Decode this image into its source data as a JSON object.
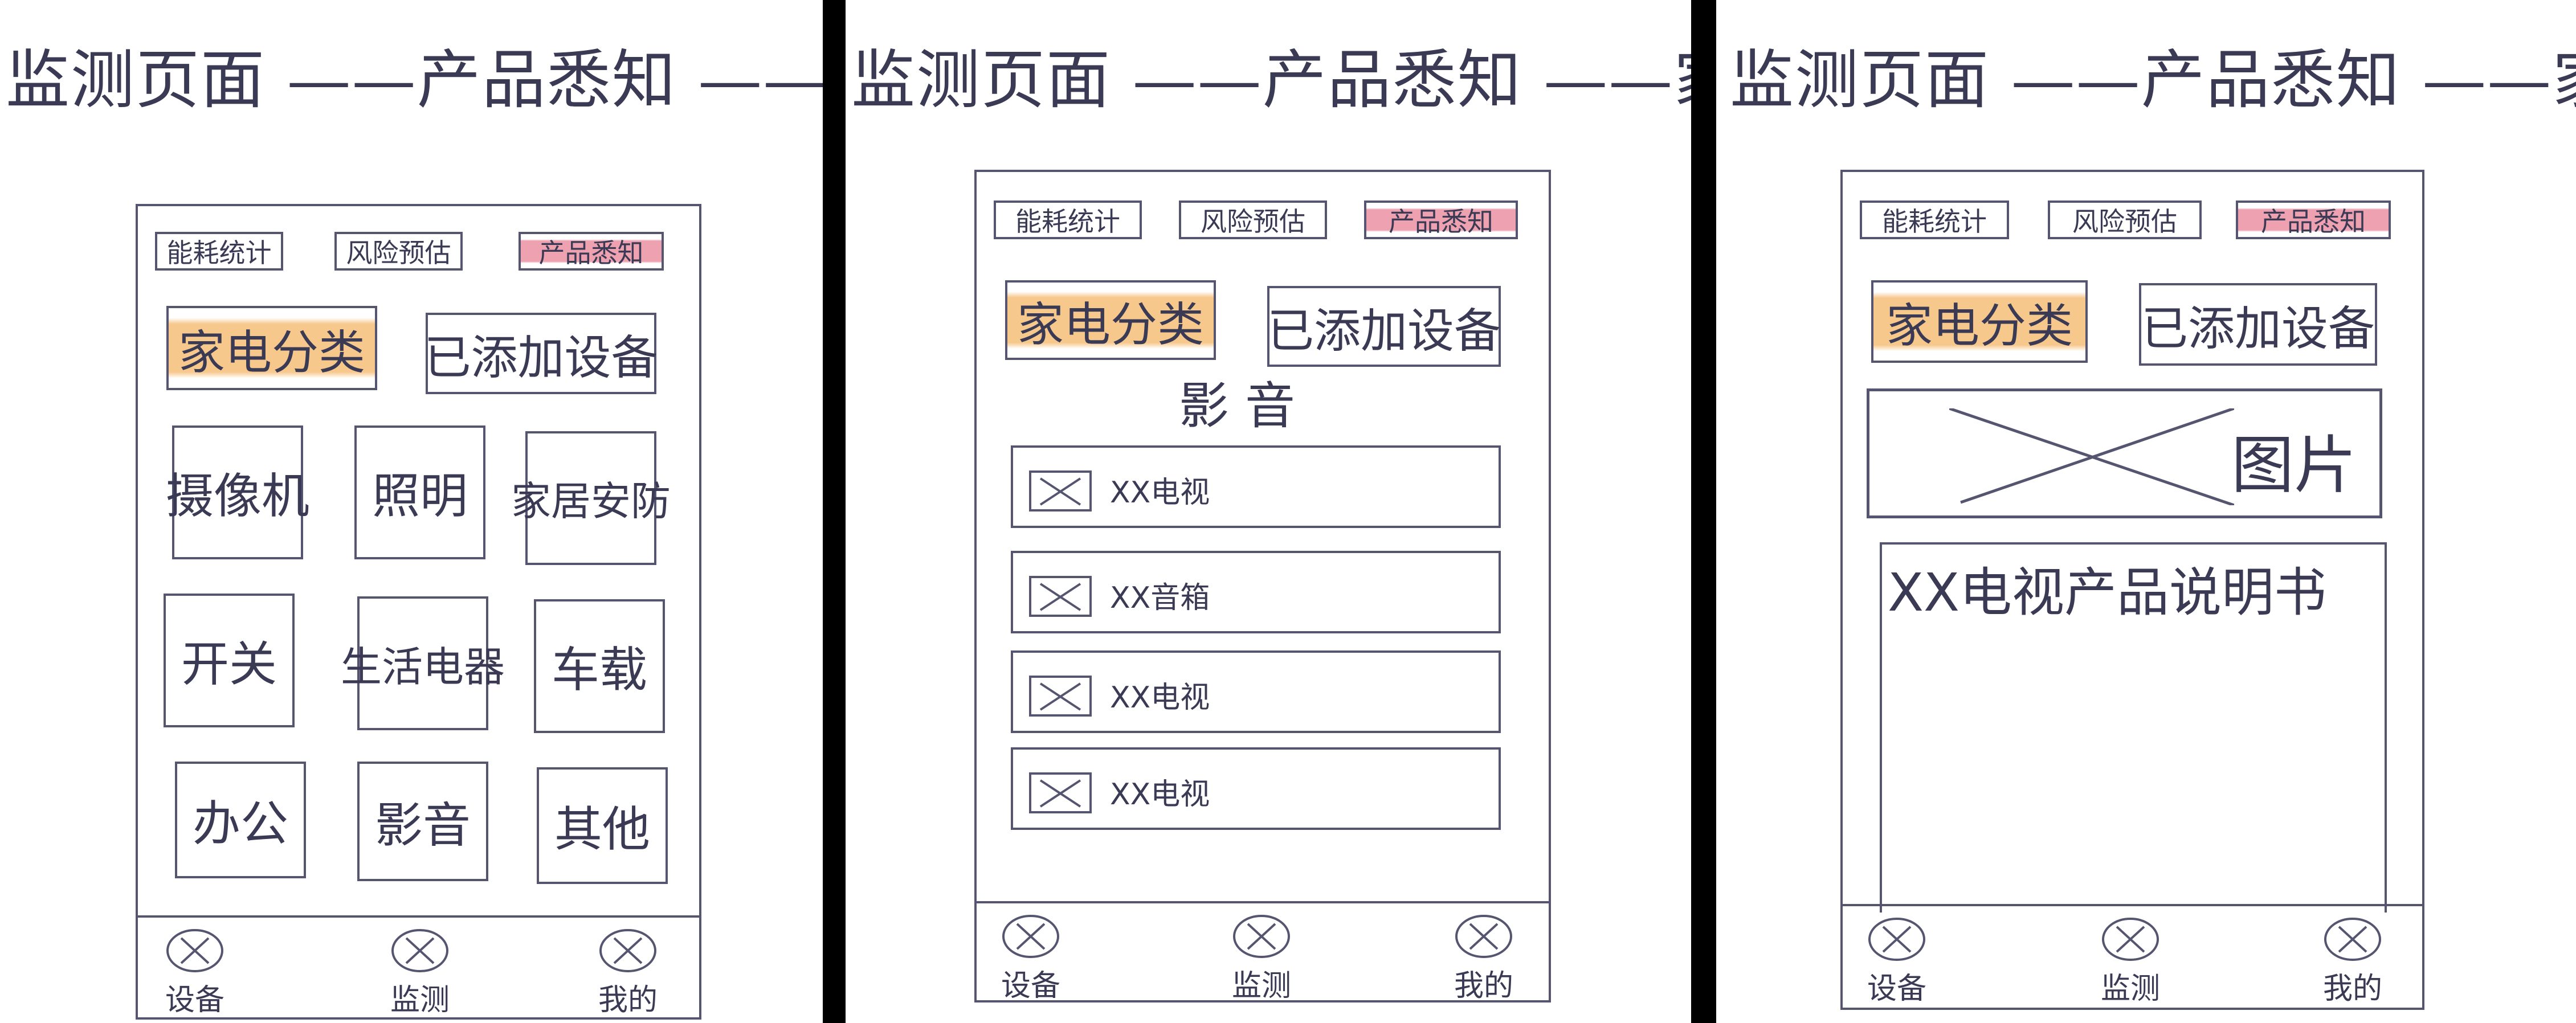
{
  "panels": [
    {
      "title": "监测页面 ——产品悉知 ——家电分类",
      "tabs": [
        "能耗统计",
        "风险预估",
        "产品悉知"
      ],
      "segments": [
        "家电分类",
        "已添加设备"
      ],
      "categories": [
        "摄像机",
        "照明",
        "家居安防",
        "开关",
        "生活电器",
        "车载",
        "办公",
        "影音",
        "其他"
      ],
      "nav": [
        "设备",
        "监测",
        "我的"
      ]
    },
    {
      "title": "监测页面 ——产品悉知 ——家电分类",
      "tabs": [
        "能耗统计",
        "风险预估",
        "产品悉知"
      ],
      "segments": [
        "家电分类",
        "已添加设备"
      ],
      "section_title": "影 音",
      "items": [
        "XX电视",
        "XX音箱",
        "XX电视",
        "XX电视"
      ],
      "nav": [
        "设备",
        "监测",
        "我的"
      ]
    },
    {
      "title": "监测页面 ——产品悉知 ——家电分类",
      "tabs": [
        "能耗统计",
        "风险预估",
        "产品悉知"
      ],
      "segments": [
        "家电分类",
        "已添加设备"
      ],
      "image_label": "图片",
      "manual_title": "XX电视产品说明书",
      "nav": [
        "设备",
        "监测",
        "我的"
      ]
    }
  ],
  "colors": {
    "tab_highlight": "#e88296",
    "segment_highlight": "#f5be78",
    "ink": "#3a3a55"
  }
}
